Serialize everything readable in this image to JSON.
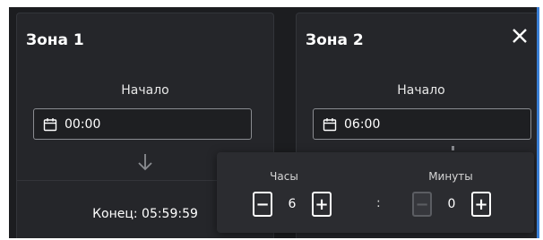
{
  "zones": [
    {
      "title": "Зона 1",
      "start_label": "Начало",
      "start_time": "00:00",
      "end_label": "Конец: 05:59:59"
    },
    {
      "title": "Зона 2",
      "start_label": "Начало",
      "start_time": "06:00"
    }
  ],
  "picker": {
    "hours_label": "Часы",
    "minutes_label": "Минуты",
    "hours_value": "6",
    "minutes_value": "0",
    "separator": ":",
    "decrement": "−",
    "increment": "+"
  },
  "colors": {
    "background": "#1c1d20",
    "panel": "#25262a",
    "popover": "#2b2c30",
    "accent": "#3a7fd6"
  }
}
